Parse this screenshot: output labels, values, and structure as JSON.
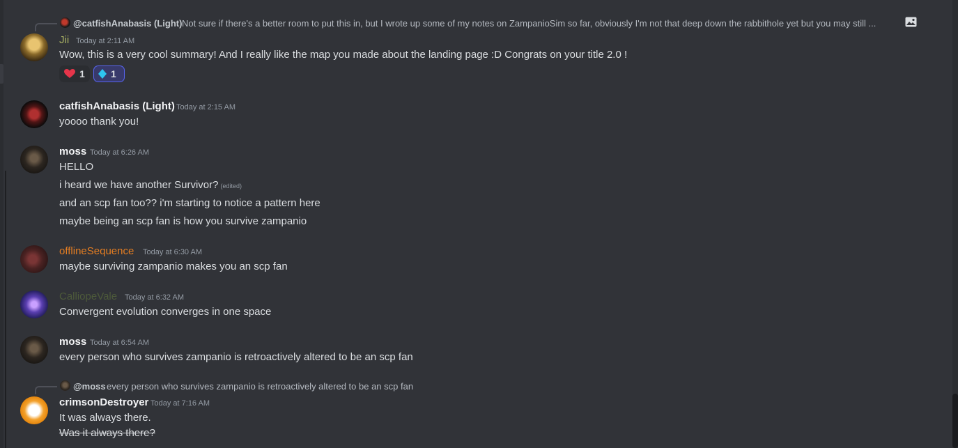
{
  "reply_1": {
    "name": "@catfishAnabasis (Light)",
    "text": "Not sure if there's a better room to put this in, but I wrote up some of my notes on ZampanioSim so far, obviously I'm not that deep down the rabbithole yet but you may still ...",
    "attachment_icon": "image-icon"
  },
  "messages": [
    {
      "author": "Jii",
      "author_color": "#a8b063",
      "time": "Today at 2:11 AM",
      "lines": [
        "Wow, this is a very cool summary! And I really like the map you made about the landing page :D Congrats on your title 2.0 !"
      ],
      "reactions": [
        {
          "emoji": "heart",
          "count": "1",
          "active": false
        },
        {
          "emoji": "blue-diamond",
          "count": "1",
          "active": true
        }
      ]
    },
    {
      "author": "catfishAnabasis (Light)",
      "author_color": "#f2f3f5",
      "time": "Today at 2:15 AM",
      "lines": [
        "yoooo thank you!"
      ]
    },
    {
      "author": "moss",
      "author_color": "#f2f3f5",
      "time": "Today at 6:26 AM",
      "lines": [
        "HELLO",
        "i heard we have another Survivor?",
        "and an scp fan too?? i'm starting to notice a pattern here",
        "maybe being an scp fan is how you survive zampanio"
      ],
      "edited_label": "(edited)"
    },
    {
      "author": "offlineSequence",
      "author_color": "#e67e22",
      "time": "Today at 6:30 AM",
      "lines": [
        "maybe surviving zampanio makes you an scp fan"
      ]
    },
    {
      "author": "CalliopeVale",
      "author_color": "#4d5a3a",
      "time": "Today at 6:32 AM",
      "lines": [
        "Convergent evolution converges in one space"
      ]
    },
    {
      "author": "moss",
      "author_color": "#f2f3f5",
      "time": "Today at 6:54 AM",
      "lines": [
        "every person who survives zampanio is retroactively altered to be an scp fan"
      ]
    },
    {
      "author": "crimsonDestroyer",
      "author_color": "#f2f3f5",
      "time": "Today at 7:16 AM",
      "lines": [
        "It was always there.",
        "Was it always there?"
      ]
    }
  ],
  "reply_2": {
    "name": "@moss",
    "text": "every person who survives zampanio is retroactively altered to be an scp fan"
  },
  "colors": {
    "background": "#313338",
    "text": "#dbdee1",
    "muted": "#949ba4",
    "reaction_active_border": "#5865f2"
  }
}
